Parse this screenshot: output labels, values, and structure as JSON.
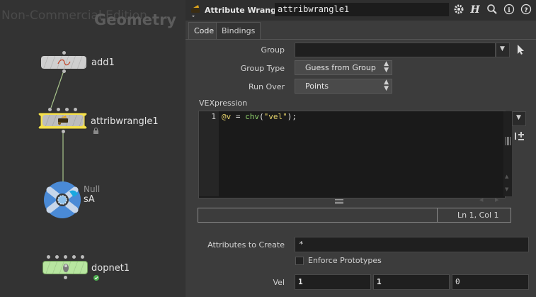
{
  "network": {
    "watermark": "Non-Commercial Edition",
    "context_label": "Geometry",
    "nodes": [
      {
        "name": "add1"
      },
      {
        "name": "attribwrangle1"
      },
      {
        "name": "sA",
        "type_label": "Null"
      },
      {
        "name": "dopnet1"
      }
    ]
  },
  "params": {
    "node_type": "Attribute Wrangle",
    "node_name": "attribwrangle1",
    "toolbar_icons": [
      "gear-icon",
      "help-h-icon",
      "search-icon",
      "info-icon",
      "question-icon"
    ],
    "tabs": [
      {
        "label": "Code",
        "active": true
      },
      {
        "label": "Bindings",
        "active": false
      }
    ],
    "group": {
      "label": "Group",
      "value": ""
    },
    "group_type": {
      "label": "Group Type",
      "value": "Guess from Group"
    },
    "run_over": {
      "label": "Run Over",
      "value": "Points"
    },
    "vexpression": {
      "label": "VEXpression",
      "line_number": "1",
      "code_var": "@v",
      "code_eq": " = ",
      "code_fn": "chv",
      "code_open": "(",
      "code_str": "\"vel\"",
      "code_close": ");",
      "status": "Ln 1, Col 1"
    },
    "attributes_to_create": {
      "label": "Attributes to Create",
      "value": "*"
    },
    "enforce_prototypes": {
      "label": "Enforce Prototypes",
      "checked": false
    },
    "vel": {
      "label": "Vel",
      "values": [
        "1",
        "1",
        "0"
      ]
    }
  },
  "colors": {
    "wrangle_node": "#f5e04a",
    "dopnet_node": "#b8e6a0",
    "null_node": "#4a8ad6",
    "code_var": "#e6d36a",
    "code_fn": "#8fd16c",
    "code_str": "#e6d36a"
  }
}
